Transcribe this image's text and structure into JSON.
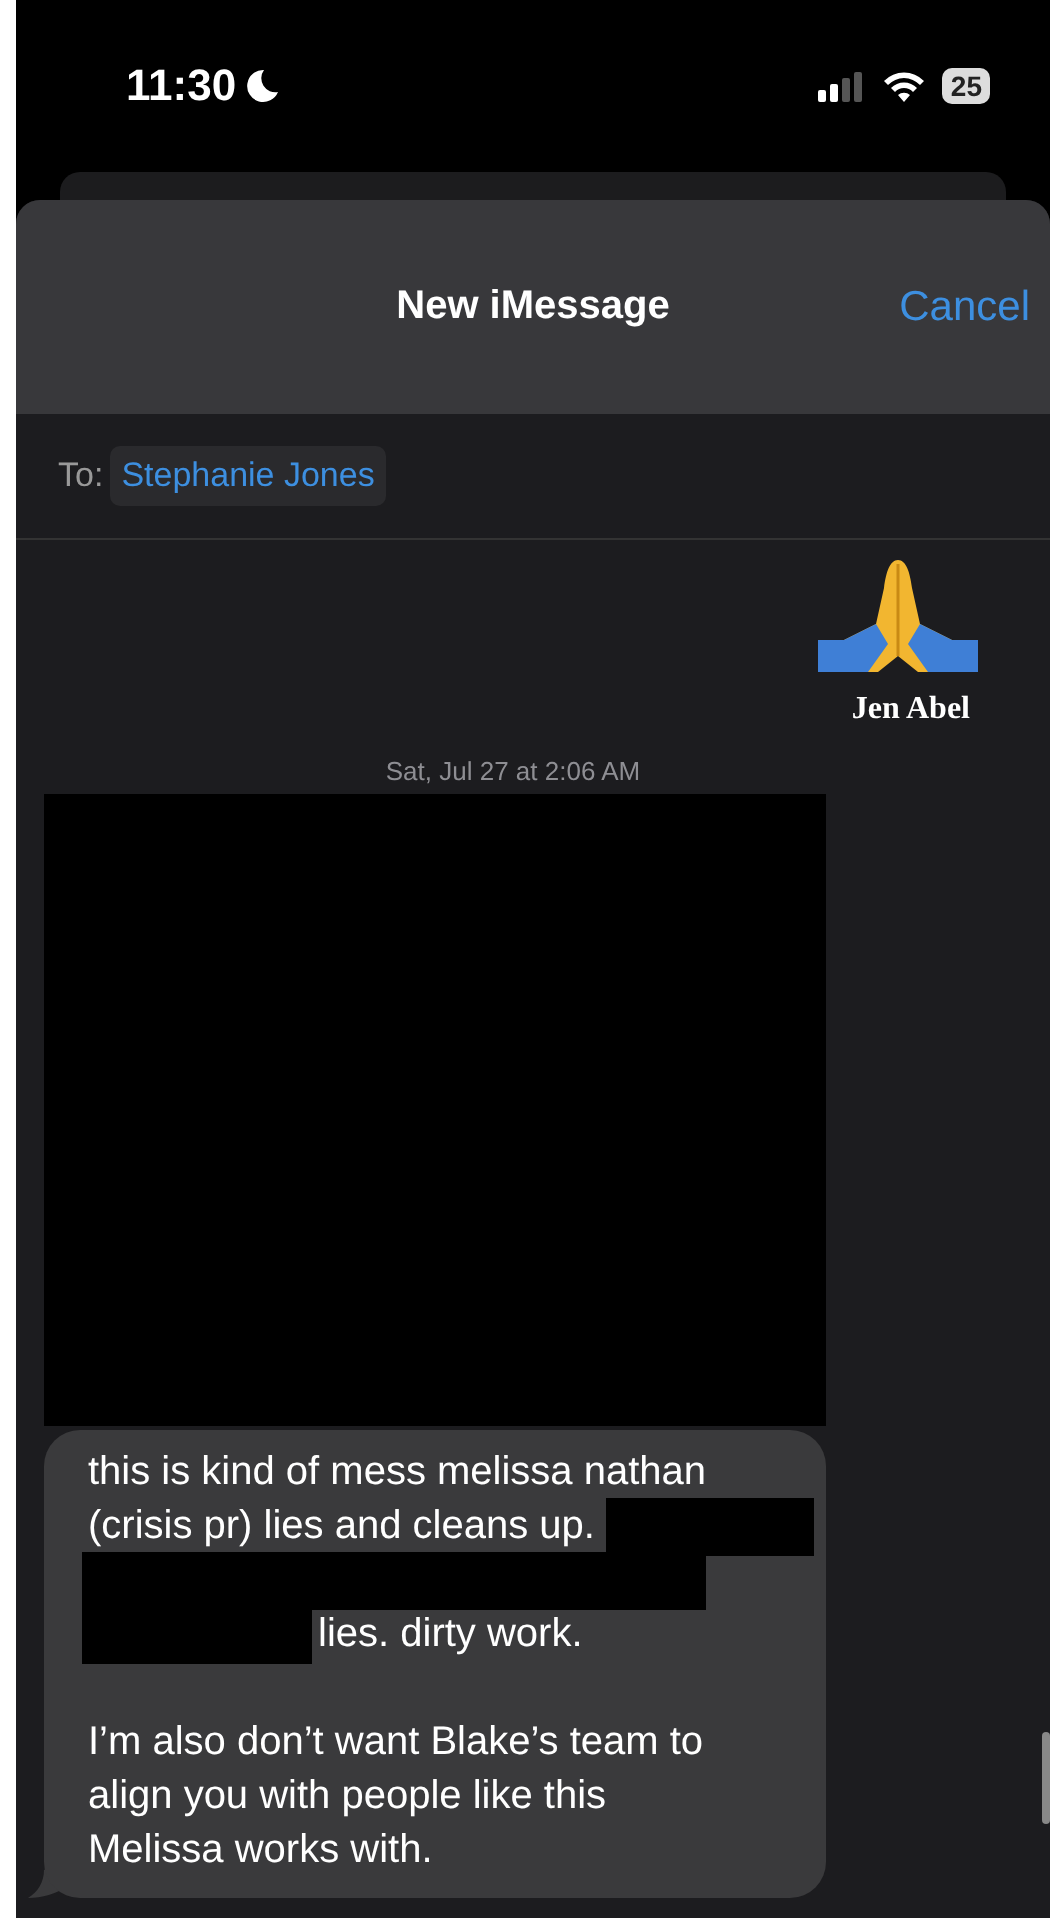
{
  "status_bar": {
    "time": "11:30",
    "battery": "25"
  },
  "header": {
    "title": "New iMessage",
    "cancel": "Cancel"
  },
  "recipient": {
    "label": "To:",
    "name": "Stephanie Jones"
  },
  "caption": {
    "name": "Jen Abel"
  },
  "timestamp": "Sat, Jul 27 at 2:06 AM",
  "attachment": {
    "kind": "redacted"
  },
  "bubble": {
    "paragraphs": [
      {
        "lines": [
          [
            {
              "kind": "text",
              "text": "this is kind of mess melissa nathan"
            }
          ],
          [
            {
              "kind": "text",
              "text": "(crisis pr) lies and cleans up."
            },
            {
              "kind": "redaction"
            }
          ],
          [
            {
              "kind": "redaction"
            }
          ],
          [
            {
              "kind": "redaction"
            },
            {
              "kind": "text",
              "text": "lies. dirty work."
            }
          ]
        ]
      },
      {
        "lines": [
          [
            {
              "kind": "text",
              "text": "I’m also don’t want Blake’s team to"
            }
          ],
          [
            {
              "kind": "text",
              "text": "align you with people like this"
            }
          ],
          [
            {
              "kind": "text",
              "text": "Melissa works with."
            }
          ]
        ]
      }
    ]
  }
}
